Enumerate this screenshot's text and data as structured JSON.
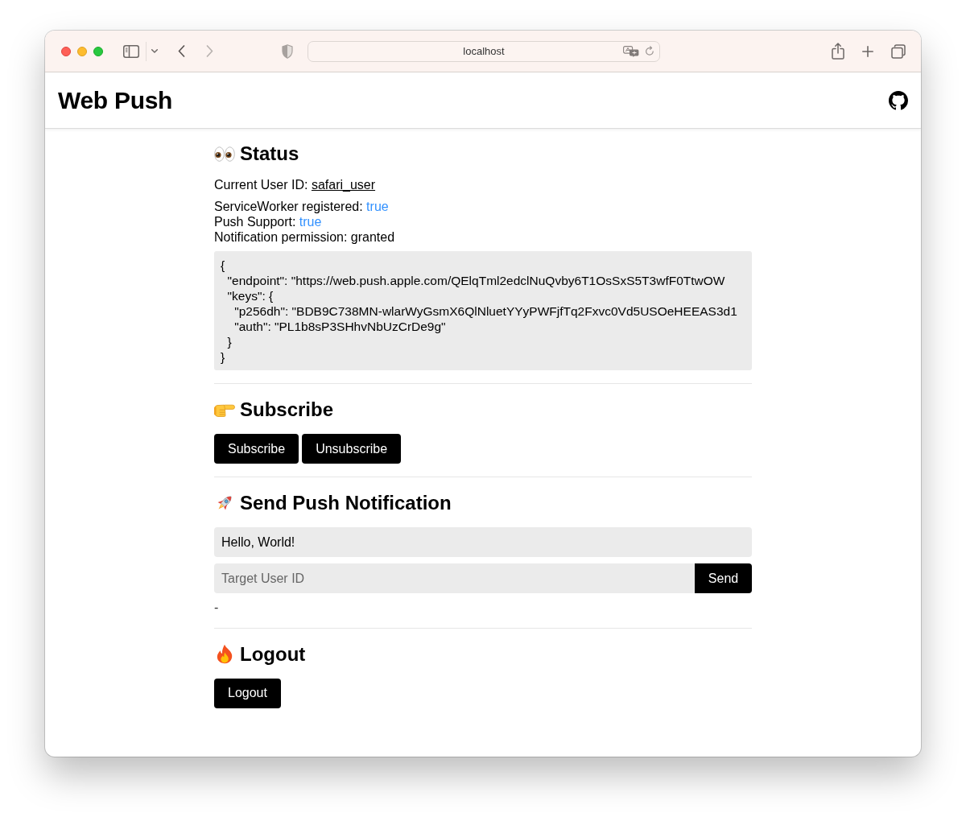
{
  "browser": {
    "address": "localhost",
    "nav": [
      {
        "kind": "back",
        "disabled": false
      },
      {
        "kind": "forward",
        "disabled": true
      }
    ]
  },
  "header": {
    "title": "Web Push"
  },
  "status": {
    "heading": "Status",
    "user_id_label": "Current User ID:",
    "user_id": "safari_user",
    "facts": [
      {
        "label": "ServiceWorker registered:",
        "value": "true",
        "kind": "flag"
      },
      {
        "label": "Push Support:",
        "value": "true",
        "kind": "flag"
      },
      {
        "label": "Notification permission:",
        "value": "granted",
        "kind": "text"
      }
    ],
    "subscription_lines": [
      "{",
      "  \"endpoint\": \"https://web.push.apple.com/QElqTml2edclNuQvby6T1OsSxS5T3wfF0TtwOW",
      "  \"keys\": {",
      "    \"p256dh\": \"BDB9C738MN-wlarWyGsmX6QlNluetYYyPWFjfTq2Fxvc0Vd5USOeHEEAS3d1",
      "    \"auth\": \"PL1b8sP3SHhvNbUzCrDe9g\"",
      "  }",
      "}"
    ]
  },
  "subscribe": {
    "heading": "Subscribe",
    "buttons": [
      "Subscribe",
      "Unsubscribe"
    ]
  },
  "send": {
    "heading": "Send Push Notification",
    "message": {
      "value": "Hello, World!"
    },
    "target": {
      "placeholder": "Target User ID"
    },
    "button": "Send",
    "result": "-"
  },
  "logout": {
    "heading": "Logout",
    "button": "Logout"
  }
}
